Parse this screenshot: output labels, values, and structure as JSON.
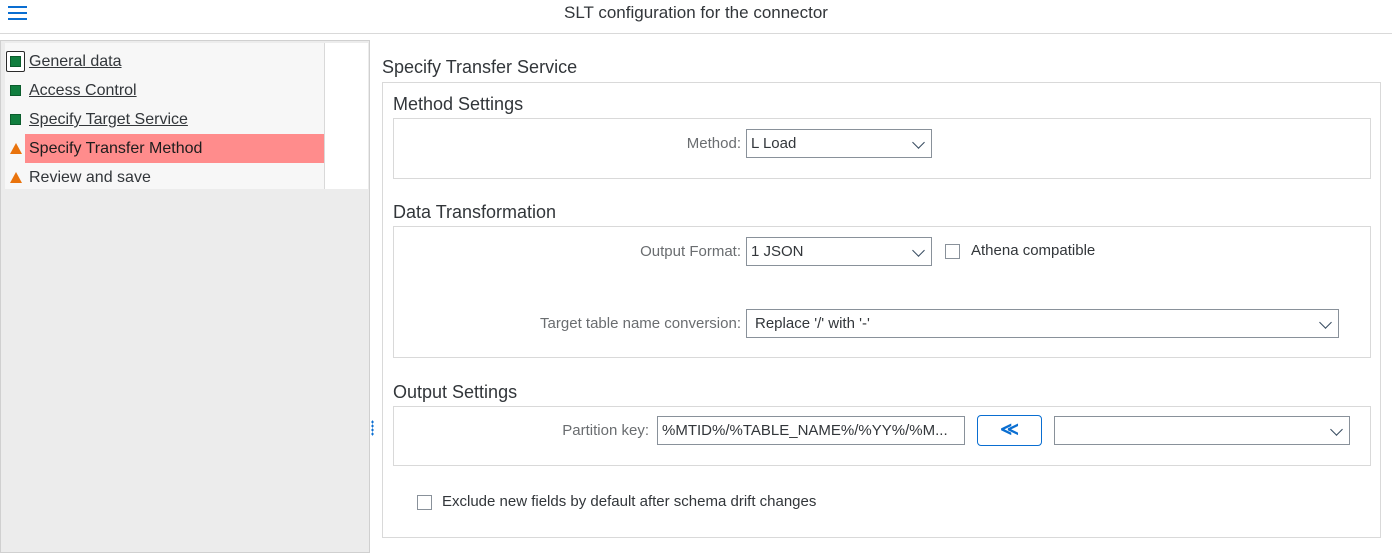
{
  "header": {
    "title": "SLT configuration for the connector",
    "menu_icon": "hamburger-menu-icon"
  },
  "nav": {
    "items": [
      {
        "label": "General data",
        "status": "complete",
        "icon": "green-square-icon"
      },
      {
        "label": "Access Control",
        "status": "complete",
        "icon": "green-square-icon"
      },
      {
        "label": "Specify Target  Service",
        "status": "complete",
        "icon": "green-square-icon"
      },
      {
        "label": "Specify Transfer Method",
        "status": "warning",
        "icon": "orange-triangle-icon"
      },
      {
        "label": "Review and save",
        "status": "warning",
        "icon": "orange-triangle-icon"
      }
    ]
  },
  "main": {
    "section_title": "Specify Transfer Service",
    "method_settings": {
      "title": "Method Settings",
      "method_label": "Method:",
      "method_value": "L Load"
    },
    "data_transformation": {
      "title": "Data Transformation",
      "output_format_label": "Output Format:",
      "output_format_value": "1 JSON",
      "athena_label": "Athena compatible",
      "athena_checked": false,
      "target_table_label": "Target table name conversion:",
      "target_table_value": "Replace '/' with '-'"
    },
    "output_settings": {
      "title": "Output Settings",
      "partition_key_label": "Partition key:",
      "partition_key_value": "%MTID%/%TABLE_NAME%/%YY%/%M...",
      "insert_button_label": "≪",
      "partition_select_value": ""
    },
    "exclude_fields_label": "Exclude new fields by default after schema drift changes",
    "exclude_fields_checked": false
  },
  "colors": {
    "accent": "#0a6ed1",
    "complete": "#107e3e",
    "warning": "#e9730c",
    "active_highlight": "#ff8c8c"
  }
}
